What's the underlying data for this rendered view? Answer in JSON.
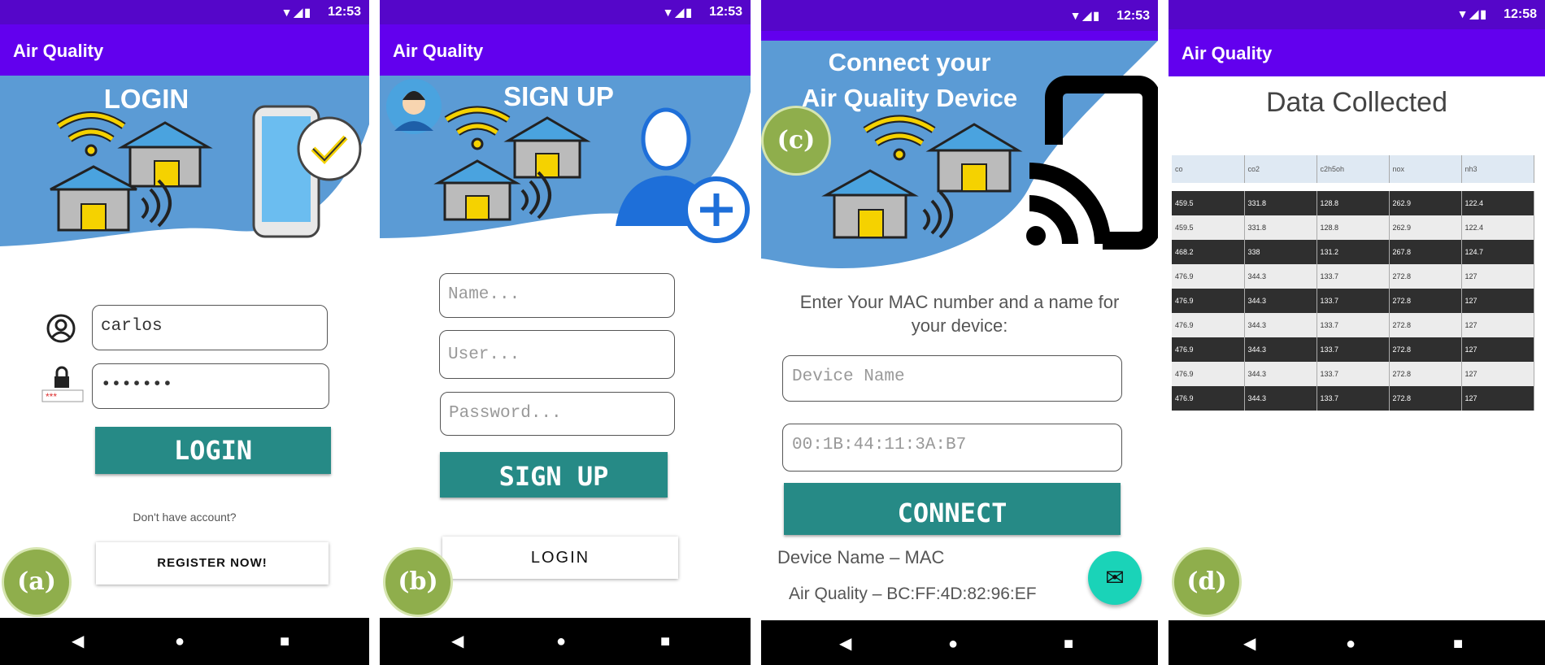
{
  "status_bar": {
    "time_a": "12:53",
    "time_b": "12:53",
    "time_c": "12:53",
    "time_d": "12:58"
  },
  "app_title": "Air Quality",
  "screen_a": {
    "badge": "(a)",
    "hero_title": "LOGIN",
    "username_value": "carlos",
    "password_value": "•••••••",
    "login_button": "LOGIN",
    "no_account_text": "Don't have account?",
    "register_button": "REGISTER NOW!"
  },
  "screen_b": {
    "badge": "(b)",
    "hero_title": "SIGN UP",
    "name_placeholder": "Name...",
    "user_placeholder": "User...",
    "password_placeholder": "Password...",
    "signup_button": "SIGN UP",
    "login_button": "LOGIN"
  },
  "screen_c": {
    "badge": "(c)",
    "hero_title_line1": "Connect your",
    "hero_title_line2": "Air Quality Device",
    "instructions_line1": "Enter Your MAC number and a name for",
    "instructions_line2": "your device:",
    "device_name_placeholder": "Device Name",
    "mac_placeholder": "00:1B:44:11:3A:B7",
    "connect_button": "CONNECT",
    "list_header": "Device Name – MAC",
    "list_item": "Air Quality – BC:FF:4D:82:96:EF"
  },
  "screen_d": {
    "badge": "(d)",
    "title": "Data Collected",
    "columns": [
      "co",
      "co2",
      "c2h5oh",
      "nox",
      "nh3"
    ],
    "rows": [
      [
        "459.5",
        "331.8",
        "128.8",
        "262.9",
        "122.4"
      ],
      [
        "459.5",
        "331.8",
        "128.8",
        "262.9",
        "122.4"
      ],
      [
        "468.2",
        "338",
        "131.2",
        "267.8",
        "124.7"
      ],
      [
        "476.9",
        "344.3",
        "133.7",
        "272.8",
        "127"
      ],
      [
        "476.9",
        "344.3",
        "133.7",
        "272.8",
        "127"
      ],
      [
        "476.9",
        "344.3",
        "133.7",
        "272.8",
        "127"
      ],
      [
        "476.9",
        "344.3",
        "133.7",
        "272.8",
        "127"
      ],
      [
        "476.9",
        "344.3",
        "133.7",
        "272.8",
        "127"
      ],
      [
        "476.9",
        "344.3",
        "133.7",
        "272.8",
        "127"
      ]
    ]
  },
  "colors": {
    "status_bar": "#5506c9",
    "app_bar": "#6200ee",
    "hero_blue": "#5b9bd5",
    "primary_button": "#268a86",
    "badge_green": "#8fae4c",
    "fab": "#1ad3b8"
  },
  "icons": {
    "user": "user-circle-icon",
    "password": "lock-password-icon",
    "fab": "mail-icon"
  }
}
